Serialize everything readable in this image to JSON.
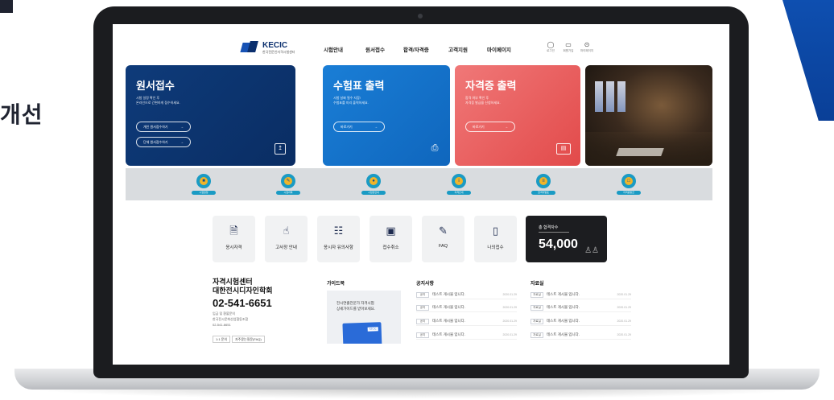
{
  "slide": {
    "title_partial": "개선"
  },
  "nav": {
    "logo_name": "KECIC",
    "logo_sub": "한국전문인자격시험센터",
    "menu": [
      "시험안내",
      "원서접수",
      "합격/자격증",
      "고객지원",
      "마이페이지"
    ],
    "utils": [
      {
        "icon": "user-icon",
        "label": "로그인"
      },
      {
        "icon": "monitor-icon",
        "label": "회원가입"
      },
      {
        "icon": "circle-icon",
        "label": "마이페이지"
      }
    ]
  },
  "hero": {
    "apply": {
      "title": "원서접수",
      "desc_1": "시험 일정 확인 후",
      "desc_2": "온라인으로 간편하게 접수하세요.",
      "btn_individual": "개인 원서접수하기",
      "btn_group": "단체 원서접수하기"
    },
    "ticket": {
      "title": "수험표 출력",
      "desc_1": "시험 날짜 필수 지참!",
      "desc_2": "수험표를 미리 출력하세요.",
      "btn": "바로가기"
    },
    "cert": {
      "title": "자격증 출력",
      "desc_1": "합격 여부 확인 후",
      "desc_2": "자격증 발급을 신청하세요.",
      "btn": "바로가기"
    }
  },
  "band": {
    "labels": [
      "시험일정",
      "시험과목",
      "시험장안내",
      "자격안내",
      "합격자발표",
      "자격증발급"
    ]
  },
  "tiles": [
    {
      "icon": "document-icon",
      "label": "응시자격"
    },
    {
      "icon": "hand-pointer-icon",
      "label": "고사장 안내"
    },
    {
      "icon": "id-card-icon",
      "label": "응시자 유의사항"
    },
    {
      "icon": "badge-icon",
      "label": "접수취소"
    },
    {
      "icon": "pencil-icon",
      "label": "FAQ"
    },
    {
      "icon": "laptop-icon",
      "label": "나의접수"
    }
  ],
  "stat": {
    "label": "총 합격자수",
    "value": "54,000"
  },
  "center": {
    "name_1": "자격시험센터",
    "name_2": "대한전시디자인학회",
    "phone": "02-541-6651",
    "meta_1": "입금 및 환불문의",
    "meta_2": "한국전시문화산업협동조합",
    "meta_3": "02-541-6651",
    "btn_1": "1:1 문의",
    "btn_2": "자주묻는질문(FAQ)"
  },
  "guide": {
    "title": "가이드북",
    "text_1": "전시연출전문가 자격시험",
    "text_2": "상세가이드를 받아보세요.",
    "book_tag": "KECIC"
  },
  "notices": {
    "title": "공지사항",
    "rows": [
      {
        "tag": "공지",
        "title": "테스트 게시물 입니다.",
        "date": "2020.01.29"
      },
      {
        "tag": "공지",
        "title": "테스트 게시물 입니다.",
        "date": "2020.01.29"
      },
      {
        "tag": "공지",
        "title": "테스트 게시물 입니다.",
        "date": "2020.01.29"
      },
      {
        "tag": "공지",
        "title": "테스트 게시물 입니다.",
        "date": "2020.01.29"
      }
    ]
  },
  "resources": {
    "title": "자료실",
    "rows": [
      {
        "tag": "자료실",
        "title": "테스트 게시물 입니다.",
        "date": "2020.01.29"
      },
      {
        "tag": "자료실",
        "title": "테스트 게시물 입니다.",
        "date": "2020.01.29"
      },
      {
        "tag": "자료실",
        "title": "테스트 게시물 입니다.",
        "date": "2020.01.29"
      },
      {
        "tag": "자료실",
        "title": "테스트 게시물 입니다.",
        "date": "2020.01.29"
      }
    ]
  }
}
